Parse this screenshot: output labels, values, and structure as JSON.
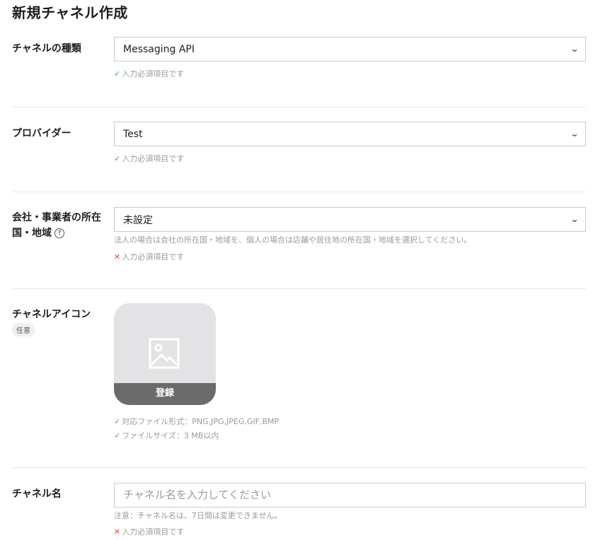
{
  "page": {
    "title": "新規チャネル作成"
  },
  "colors": {
    "ok": "#3bb54a",
    "error": "#e64b3c",
    "border": "#c9c9c9",
    "icon_bg": "#e3e3e6",
    "register_bg": "#6b6b6b"
  },
  "channel_type": {
    "label": "チャネルの種類",
    "value": "Messaging API",
    "status": "入力必須項目です",
    "status_icon": "check-icon"
  },
  "provider": {
    "label": "プロバイダー",
    "value": "Test",
    "status": "入力必須項目です",
    "status_icon": "check-icon"
  },
  "country": {
    "label_line1": "会社・事業者の所在",
    "label_line2": "国・地域",
    "help_glyph": "?",
    "value": "未設定",
    "hint": "法人の場合は会社の所在国・地域を、個人の場合は店舗や居住地の所在国・地域を選択してください。",
    "status": "入力必須項目です",
    "status_icon": "cross-icon"
  },
  "channel_icon": {
    "label": "チャネルアイコン",
    "badge": "任意",
    "register_label": "登録",
    "notes": [
      "対応ファイル形式：PNG,JPG,JPEG,GIF,BMP",
      "ファイルサイズ：3 MB以内"
    ]
  },
  "channel_name": {
    "label": "チャネル名",
    "value": "",
    "placeholder": "チャネル名を入力してください",
    "hint": "注意：チャネル名は、7日間は変更できません。",
    "status": "入力必須項目です",
    "status_icon": "cross-icon"
  }
}
